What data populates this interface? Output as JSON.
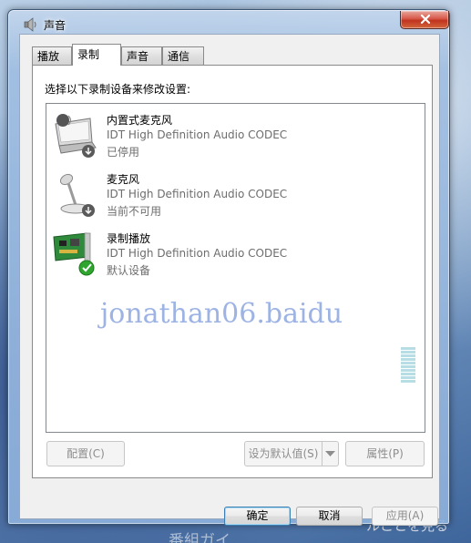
{
  "window": {
    "title": "声音",
    "close_symbol": "x"
  },
  "tabs": [
    {
      "label": "播放",
      "active": false
    },
    {
      "label": "录制",
      "active": true
    },
    {
      "label": "声音",
      "active": false
    },
    {
      "label": "通信",
      "active": false
    }
  ],
  "instruction": "选择以下录制设备来修改设置:",
  "devices": [
    {
      "name": "内置式麦克风",
      "driver": "IDT High Definition Audio CODEC",
      "status": "已停用",
      "icon": "laptop-microphone-icon",
      "badge": "down-arrow-badge-icon"
    },
    {
      "name": "麦克风",
      "driver": "IDT High Definition Audio CODEC",
      "status": "当前不可用",
      "icon": "desk-microphone-icon",
      "badge": "down-arrow-badge-icon"
    },
    {
      "name": "录制播放",
      "driver": "IDT High Definition Audio CODEC",
      "status": "默认设备",
      "icon": "sound-card-icon",
      "badge": "green-check-badge-icon"
    }
  ],
  "watermark": "jonathan06.baidu",
  "buttons": {
    "configure": "配置(C)",
    "set_default": "设为默认值(S)",
    "properties": "属性(P)",
    "ok": "确定",
    "cancel": "取消",
    "apply": "应用(A)"
  },
  "colors": {
    "disabled_text": "#8d8d8d",
    "level_meter": "#b7dde5",
    "default_check": "#2fa52f"
  },
  "wallpaper": {
    "text_right": "ルことを見る",
    "text_bottom": "番組ガイ"
  }
}
